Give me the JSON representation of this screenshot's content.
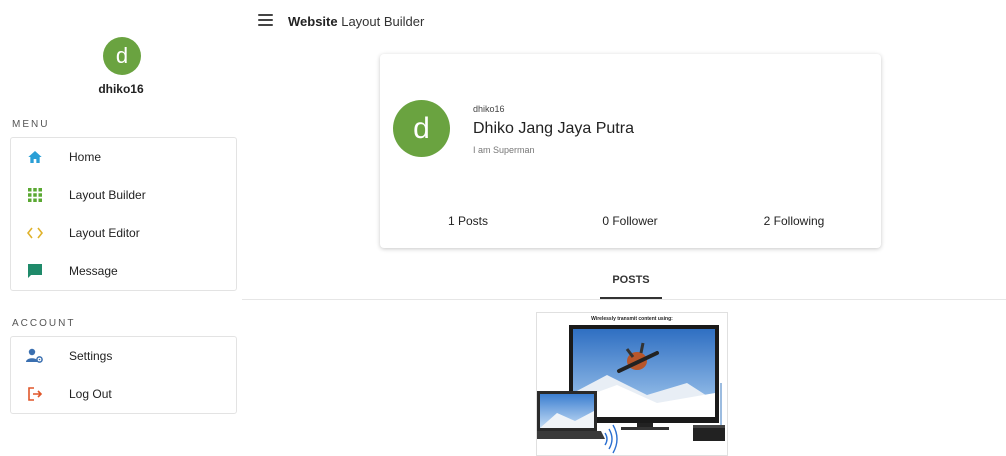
{
  "app": {
    "title_bold": "Website",
    "title_rest": " Layout Builder"
  },
  "sidebar": {
    "avatar_letter": "d",
    "username": "dhiko16",
    "menu_label": "MENU",
    "menu_items": [
      {
        "label": "Home",
        "icon": "home-icon"
      },
      {
        "label": "Layout Builder",
        "icon": "grid-icon"
      },
      {
        "label": "Layout Editor",
        "icon": "code-icon"
      },
      {
        "label": "Message",
        "icon": "message-icon"
      }
    ],
    "account_label": "ACCOUNT",
    "account_items": [
      {
        "label": "Settings",
        "icon": "user-settings-icon"
      },
      {
        "label": "Log Out",
        "icon": "logout-icon"
      }
    ]
  },
  "profile": {
    "avatar_letter": "d",
    "handle": "dhiko16",
    "name": "Dhiko Jang Jaya Putra",
    "bio": "I am Superman",
    "stats": {
      "posts": "1 Posts",
      "followers": "0 Follower",
      "following": "2 Following"
    }
  },
  "tabs": {
    "posts": "POSTS"
  },
  "post": {
    "caption": "Wirelessly transmit content using:"
  },
  "colors": {
    "avatar": "#6aa340",
    "home_icon": "#2a9fd6",
    "grid_icon": "#5aa832",
    "code_icon": "#e0b22a",
    "message_icon": "#1f8a6a",
    "settings_icon": "#3a6fb0",
    "logout_icon": "#e0562a"
  }
}
